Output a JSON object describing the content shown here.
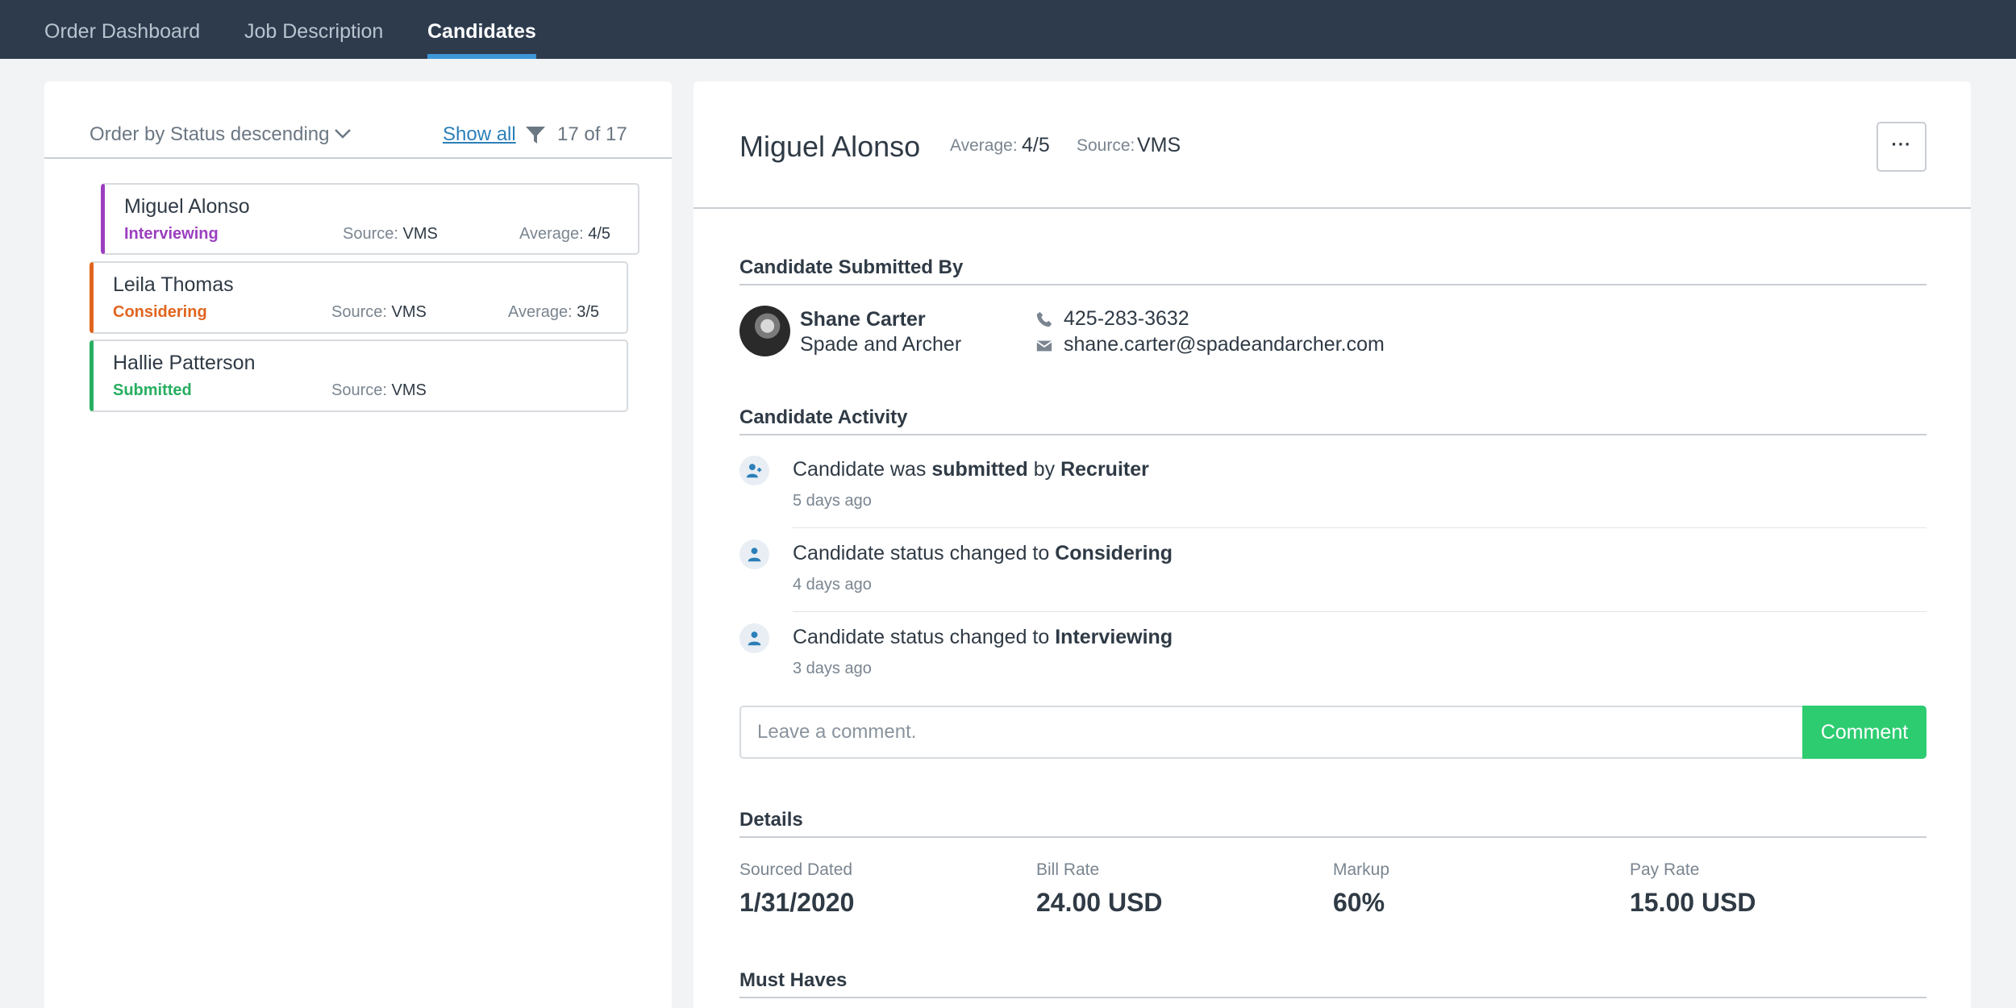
{
  "nav": {
    "tabs": [
      {
        "label": "Order Dashboard"
      },
      {
        "label": "Job Description"
      },
      {
        "label": "Candidates"
      }
    ]
  },
  "list": {
    "order_label": "Order by Status descending",
    "show_all": "Show all",
    "count": "17 of 17",
    "source_label": "Source:",
    "average_label": "Average:",
    "candidates": [
      {
        "name": "Miguel Alonso",
        "status": "Interviewing",
        "source": "VMS",
        "average": "4/5",
        "color": "#9b3fbf"
      },
      {
        "name": "Leila Thomas",
        "status": "Considering",
        "source": "VMS",
        "average": "3/5",
        "color": "#e0651f"
      },
      {
        "name": "Hallie Patterson",
        "status": "Submitted",
        "source": "VMS",
        "average": "",
        "color": "#27ae60"
      }
    ]
  },
  "detail": {
    "name": "Miguel Alonso",
    "average_label": "Average:",
    "average": "4/5",
    "source_label": "Source:",
    "source": "VMS",
    "more_button": "···",
    "submitted_by": {
      "title": "Candidate Submitted By",
      "name": "Shane Carter",
      "company": "Spade and Archer",
      "phone": "425-283-3632",
      "email": "shane.carter@spadeandarcher.com"
    },
    "activity": {
      "title": "Candidate Activity",
      "items": [
        {
          "prefix": "Candidate was ",
          "bold": "submitted",
          "mid": " by ",
          "bold2": "Recruiter",
          "time": "5 days ago",
          "icon": "user-plus-icon"
        },
        {
          "prefix": "Candidate status changed to ",
          "bold": "Considering",
          "time": "4 days ago",
          "icon": "user-icon"
        },
        {
          "prefix": "Candidate status changed to ",
          "bold": "Interviewing",
          "time": "3 days ago",
          "icon": "user-icon"
        }
      ]
    },
    "comment": {
      "placeholder": "Leave a comment.",
      "button": "Comment"
    },
    "details": {
      "title": "Details",
      "fields": [
        {
          "label": "Sourced Dated",
          "value": "1/31/2020"
        },
        {
          "label": "Bill Rate",
          "value": "24.00 USD"
        },
        {
          "label": "Markup",
          "value": "60%"
        },
        {
          "label": "Pay Rate",
          "value": "15.00 USD"
        }
      ]
    },
    "must_haves": {
      "title": "Must Haves"
    }
  }
}
